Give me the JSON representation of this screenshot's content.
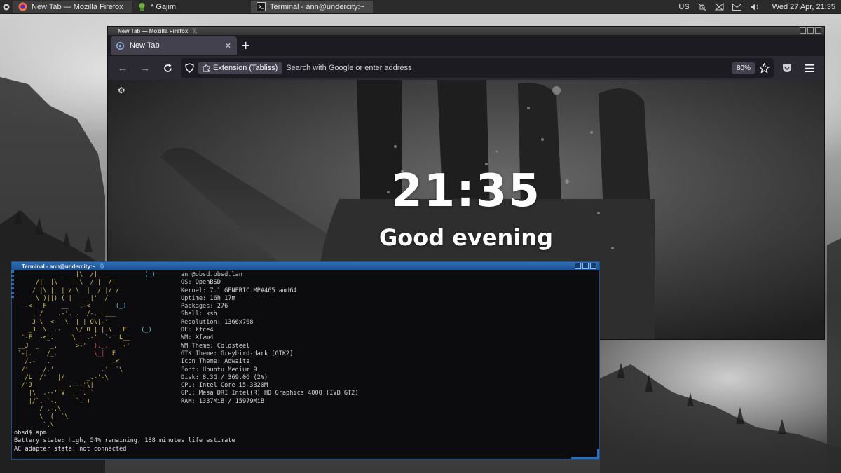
{
  "panel": {
    "tasks": [
      {
        "label": "New Tab — Mozilla Firefox",
        "icon": "firefox-icon"
      },
      {
        "label": "* Gajim",
        "icon": "gajim-icon"
      },
      {
        "label": "Terminal - ann@undercity:~",
        "icon": "terminal-icon"
      }
    ],
    "keyboard_layout": "US",
    "clock": "Wed 27 Apr, 21:35"
  },
  "firefox": {
    "window_title": "New Tab — Mozilla Firefox",
    "tab_label": "New Tab",
    "extension_chip": "Extension (Tabliss)",
    "url_placeholder": "Search with Google or enter address",
    "zoom": "80%",
    "newtab": {
      "time": "21:35",
      "greeting": "Good evening"
    }
  },
  "terminal": {
    "window_title": "Terminal - ann@undercity:~",
    "user_host": "ann@obsd.obsd.lan",
    "sysinfo": [
      {
        "key": "OS",
        "value": "OpenBSD"
      },
      {
        "key": "Kernel",
        "value": "7.1 GENERIC.MP#465 amd64"
      },
      {
        "key": "Uptime",
        "value": "16h 17m"
      },
      {
        "key": "Packages",
        "value": "276"
      },
      {
        "key": "Shell",
        "value": "ksh"
      },
      {
        "key": "Resolution",
        "value": "1366x768"
      },
      {
        "key": "DE",
        "value": "Xfce4"
      },
      {
        "key": "WM",
        "value": "Xfwm4"
      },
      {
        "key": "WM Theme",
        "value": "Coldsteel"
      },
      {
        "key": "GTK Theme",
        "value": "Greybird-dark [GTK2]"
      },
      {
        "key": "Icon Theme",
        "value": "Adwaita"
      },
      {
        "key": "Font",
        "value": "Ubuntu Medium 9"
      },
      {
        "key": "Disk",
        "value": "8.3G / 369.0G (2%)"
      },
      {
        "key": "CPU",
        "value": "Intel Core i5-3320M"
      },
      {
        "key": "GPU",
        "value": "Mesa DRI Intel(R) HD Graphics 4000 (IVB GT2)"
      },
      {
        "key": "RAM",
        "value": "1337MiB / 15979MiB"
      }
    ],
    "prompt_line": "obsd$ apm",
    "apm_battery": "Battery state: high, 54% remaining, 188 minutes life estimate",
    "apm_ac": "AC adapter state: not connected"
  },
  "colors": {
    "terminal_accent": "#2f6fb7",
    "ascii_art": "#d8c35a"
  }
}
